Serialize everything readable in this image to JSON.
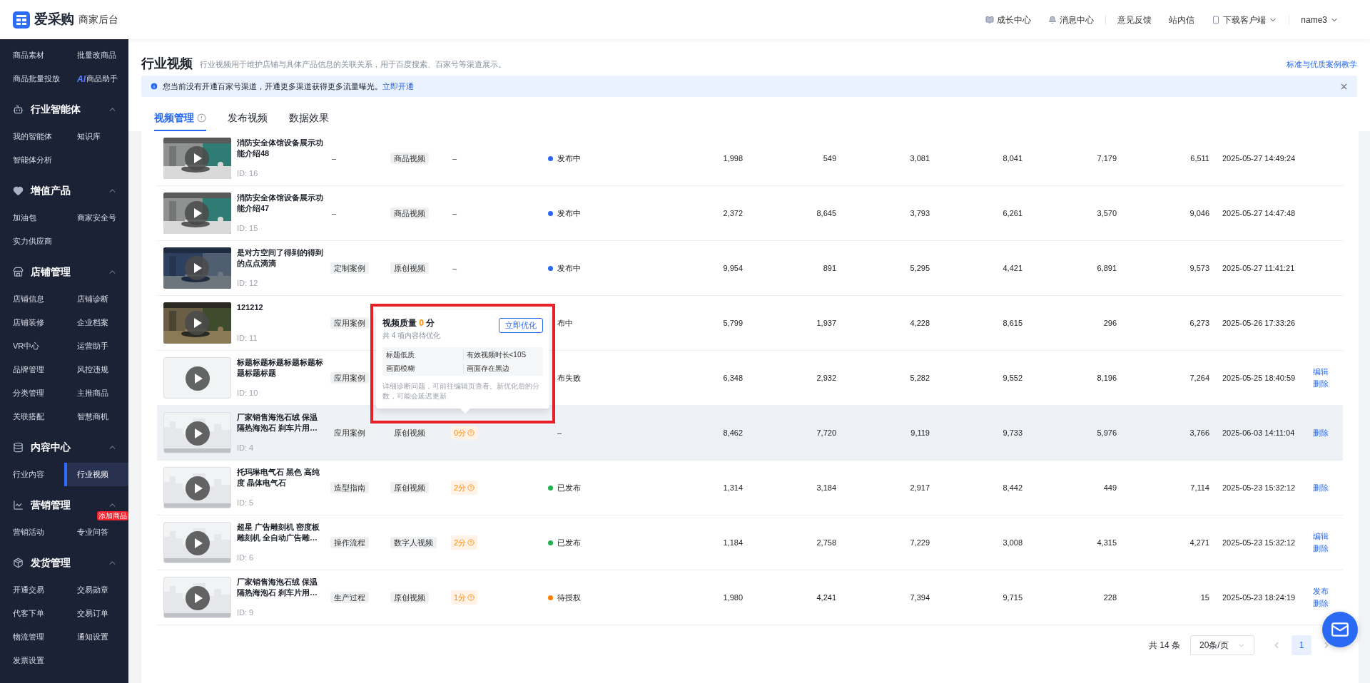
{
  "header": {
    "logo_text": "爱采购",
    "subtitle": "商家后台",
    "link_groups": [
      [
        {
          "label": "成长中心"
        },
        {
          "label": "消息中心"
        }
      ],
      [
        {
          "label": "意见反馈"
        },
        {
          "label": "站内信"
        },
        {
          "label": "下载客户端",
          "dropdown": true
        }
      ],
      [
        {
          "label": "name3",
          "dropdown": true
        }
      ]
    ]
  },
  "sidebar": {
    "sections": [
      {
        "items": [
          {
            "label": "商品素材",
            "selected": false
          },
          {
            "label": "批量改商品",
            "selected": false
          },
          {
            "label": "商品批量投放",
            "selected": false
          },
          {
            "label": "商品助手",
            "prefix": "AI",
            "selected": false
          }
        ]
      },
      {
        "title": "行业智能体",
        "expanded": true,
        "items": [
          {
            "label": "我的智能体",
            "selected": false
          },
          {
            "label": "知识库",
            "selected": false
          },
          {
            "label": "智能体分析",
            "selected": false
          }
        ]
      },
      {
        "title": "增值产品",
        "expanded": true,
        "items": [
          {
            "label": "加油包",
            "selected": false
          },
          {
            "label": "商家安全号",
            "selected": false
          },
          {
            "label": "实力供应商",
            "selected": false
          }
        ]
      },
      {
        "title": "店铺管理",
        "expanded": true,
        "items": [
          {
            "label": "店铺信息",
            "selected": false
          },
          {
            "label": "店铺诊断",
            "selected": false
          },
          {
            "label": "店铺装修",
            "selected": false
          },
          {
            "label": "企业档案",
            "selected": false
          },
          {
            "label": "VR中心",
            "selected": false
          },
          {
            "label": "运营助手",
            "selected": false
          },
          {
            "label": "品牌管理",
            "selected": false
          },
          {
            "label": "风控违规",
            "selected": false
          },
          {
            "label": "分类管理",
            "selected": false
          },
          {
            "label": "主推商品",
            "selected": false
          },
          {
            "label": "关联搭配",
            "selected": false
          },
          {
            "label": "智慧商机",
            "selected": false
          }
        ]
      },
      {
        "title": "内容中心",
        "expanded": true,
        "items": [
          {
            "label": "行业内容",
            "selected": false
          },
          {
            "label": "行业视频",
            "selected": true
          }
        ]
      },
      {
        "title": "营销管理",
        "expanded": true,
        "items": [
          {
            "label": "营销活动",
            "selected": false
          },
          {
            "label": "专业问答",
            "badge": "添加商品",
            "selected": false
          }
        ]
      },
      {
        "title": "发货管理",
        "expanded": true,
        "items": [
          {
            "label": "开通交易",
            "selected": false
          },
          {
            "label": "交易勋章",
            "selected": false
          },
          {
            "label": "代客下单",
            "selected": false
          },
          {
            "label": "交易订单",
            "selected": false
          },
          {
            "label": "物流管理",
            "selected": false
          },
          {
            "label": "通知设置",
            "selected": false
          },
          {
            "label": "发票设置",
            "selected": false
          }
        ]
      }
    ]
  },
  "page": {
    "title": "行业视频",
    "description": "行业视频用于维护店铺与具体产品信息的关联关系，用于百度搜索、百家号等渠道展示。",
    "help_link": "标准与优质案例教学"
  },
  "alert": {
    "text": "您当前没有开通百家号渠道，开通更多渠道获得更多流量曝光。",
    "link": "立即开通"
  },
  "tabs": [
    {
      "label": "视频管理",
      "info": true,
      "selected": true
    },
    {
      "label": "发布视频",
      "selected": false
    },
    {
      "label": "数据效果",
      "selected": false
    }
  ],
  "table": {
    "rows": [
      {
        "thumbnail": {
          "kind": "picture"
        },
        "title": "消防安全体馆设备展示功能介绍48",
        "id": "ID: 16",
        "case": {
          "kind": "dash",
          "text": "–"
        },
        "type": {
          "kind": "tag",
          "text": "商品视频"
        },
        "score": {
          "kind": "dash",
          "text": "–"
        },
        "status": {
          "text": "发布中",
          "color": "#2b66f6"
        },
        "numbers": [
          "1,998",
          "549",
          "3,081",
          "8,041",
          "7,179",
          "6,511"
        ],
        "date": "2025-05-27 14:49:24",
        "actions": [],
        "highlighted": false
      },
      {
        "thumbnail": {
          "kind": "picture"
        },
        "title": "消防安全体馆设备展示功能介绍47",
        "id": "ID: 15",
        "case": {
          "kind": "dash",
          "text": "–"
        },
        "type": {
          "kind": "tag",
          "text": "商品视频"
        },
        "score": {
          "kind": "dash",
          "text": "–"
        },
        "status": {
          "text": "发布中",
          "color": "#2b66f6"
        },
        "numbers": [
          "2,372",
          "8,645",
          "3,793",
          "6,261",
          "3,570",
          "9,046"
        ],
        "date": "2025-05-27 14:47:48",
        "actions": [],
        "highlighted": false
      },
      {
        "thumbnail": {
          "kind": "picture"
        },
        "title": "是对方空间了得到的得到的点点滴滴",
        "id": "ID: 12",
        "case": {
          "kind": "tag",
          "text": "定制案例"
        },
        "type": {
          "kind": "tag",
          "text": "原创视频"
        },
        "score": {
          "kind": "dash",
          "text": "–"
        },
        "status": {
          "text": "发布中",
          "color": "#2b66f6"
        },
        "numbers": [
          "9,954",
          "891",
          "5,295",
          "4,421",
          "6,891",
          "9,573"
        ],
        "date": "2025-05-27 11:41:21",
        "actions": [],
        "highlighted": false
      },
      {
        "thumbnail": {
          "kind": "picture"
        },
        "title": "121212",
        "id": "ID: 11",
        "case": {
          "kind": "tag",
          "text": "应用案例"
        },
        "status": {
          "text": "布中"
        },
        "numbers": [
          "5,799",
          "1,937",
          "4,228",
          "8,615",
          "296",
          "6,273"
        ],
        "date": "2025-05-26 17:33:26",
        "actions": [],
        "highlighted": false
      },
      {
        "thumbnail": {
          "kind": "blank"
        },
        "title": "标题标题标题标题标题标题标题标题",
        "id": "ID: 10",
        "case": {
          "kind": "tag",
          "text": "应用案例"
        },
        "status": {
          "text": "布失败"
        },
        "numbers": [
          "6,348",
          "2,932",
          "5,282",
          "9,552",
          "8,196",
          "7,264"
        ],
        "date": "2025-05-25 18:40:59",
        "actions": [
          "编辑",
          "删除"
        ],
        "highlighted": false
      },
      {
        "thumbnail": {
          "kind": "default"
        },
        "title": "厂家销售海泡石绒 保温隔热海泡石 刹车片用…",
        "id": "ID: 4",
        "case": {
          "kind": "tag",
          "text": "应用案例"
        },
        "type": {
          "kind": "tag",
          "text": "原创视频"
        },
        "score": {
          "kind": "badge",
          "text": "0分"
        },
        "status": {
          "text": "–"
        },
        "numbers": [
          "8,462",
          "7,720",
          "9,119",
          "9,733",
          "5,976",
          "3,766"
        ],
        "date": "2025-06-03 14:11:04",
        "actions": [
          "删除"
        ],
        "highlighted": true
      },
      {
        "thumbnail": {
          "kind": "default"
        },
        "title": "托玛琳电气石 黑色 高纯度 晶体电气石",
        "id": "ID: 5",
        "case": {
          "kind": "tag",
          "text": "造型指南"
        },
        "type": {
          "kind": "tag",
          "text": "原创视频"
        },
        "score": {
          "kind": "badge",
          "text": "2分"
        },
        "status": {
          "text": "已发布",
          "color": "#22b14c"
        },
        "numbers": [
          "1,314",
          "3,184",
          "2,917",
          "8,442",
          "449",
          "7,114"
        ],
        "date": "2025-05-23 15:32:12",
        "actions": [
          "删除"
        ],
        "highlighted": false
      },
      {
        "thumbnail": {
          "kind": "default"
        },
        "title": "超星 广告雕刻机 密度板雕刻机 全自动广告雕…",
        "id": "ID: 6",
        "case": {
          "kind": "tag",
          "text": "操作流程"
        },
        "type": {
          "kind": "tag",
          "text": "数字人视频"
        },
        "score": {
          "kind": "badge",
          "text": "2分"
        },
        "status": {
          "text": "已发布",
          "color": "#22b14c"
        },
        "numbers": [
          "1,184",
          "2,758",
          "7,229",
          "3,008",
          "4,315",
          "4,271"
        ],
        "date": "2025-05-23 15:32:12",
        "actions": [
          "编辑",
          "删除"
        ],
        "highlighted": false
      },
      {
        "thumbnail": {
          "kind": "default"
        },
        "title": "厂家销售海泡石绒 保温隔热海泡石 刹车片用…",
        "id": "ID: 9",
        "case": {
          "kind": "tag",
          "text": "生产过程"
        },
        "type": {
          "kind": "tag",
          "text": "原创视频"
        },
        "score": {
          "kind": "badge",
          "text": "1分"
        },
        "status": {
          "text": "待授权",
          "color": "#ff7d00"
        },
        "numbers": [
          "1,980",
          "4,241",
          "7,394",
          "9,715",
          "228",
          "15"
        ],
        "date": "2025-05-23 18:24:19",
        "actions": [
          "发布",
          "删除"
        ],
        "highlighted": false
      }
    ]
  },
  "popover": {
    "title": "视频质量",
    "score": "0",
    "unit": "分",
    "subtitle": "共 4 项内容待优化",
    "button": "立即优化",
    "issues": [
      "标题低质",
      "有效视频时长<10S",
      "画面模糊",
      "画面存在黑边"
    ],
    "note": "详细诊断问题，可前往编辑页查看。新优化后的分数，可能会延迟更新"
  },
  "pagination": {
    "total": "共 14 条",
    "page_size": "20条/页",
    "pages": [
      {
        "label": "1",
        "selected": true
      }
    ]
  }
}
